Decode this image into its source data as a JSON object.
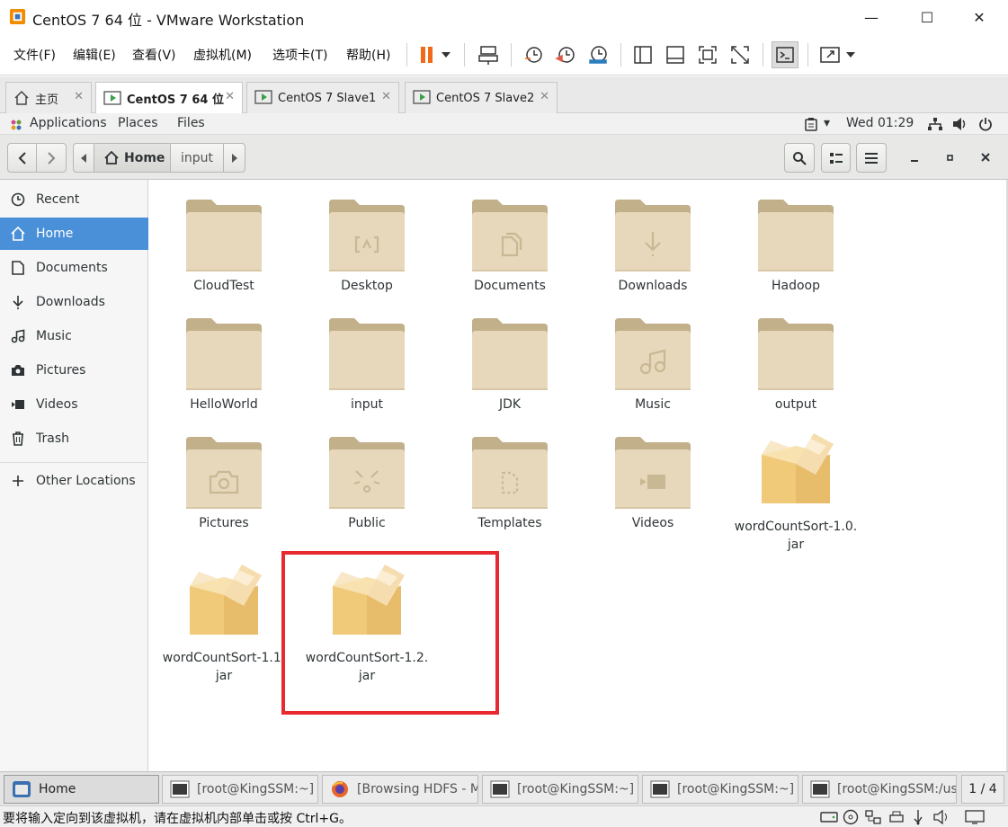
{
  "window": {
    "title": "CentOS 7 64 位 - VMware Workstation",
    "minimize": "—",
    "maximize": "☐",
    "close": "✕"
  },
  "menu": {
    "items": [
      "文件(F)",
      "编辑(E)",
      "查看(V)",
      "虚拟机(M)",
      "选项卡(T)",
      "帮助(H)"
    ]
  },
  "vm_tabs": [
    {
      "label": "主页",
      "icon": "home-icon"
    },
    {
      "label": "CentOS 7 64 位",
      "icon": "vm-play-icon",
      "active": true
    },
    {
      "label": "CentOS 7 Slave1",
      "icon": "vm-play-icon"
    },
    {
      "label": "CentOS 7 Slave2",
      "icon": "vm-play-icon"
    }
  ],
  "gnome_bar": {
    "applications": "Applications",
    "places": "Places",
    "files": "Files",
    "clock": "Wed 01:29"
  },
  "nautilus": {
    "path": [
      "Home",
      "input"
    ]
  },
  "sidebar": {
    "items": [
      {
        "label": "Recent",
        "icon": "clock-icon"
      },
      {
        "label": "Home",
        "icon": "home-icon",
        "active": true
      },
      {
        "label": "Documents",
        "icon": "document-icon"
      },
      {
        "label": "Downloads",
        "icon": "download-icon"
      },
      {
        "label": "Music",
        "icon": "music-icon"
      },
      {
        "label": "Pictures",
        "icon": "camera-icon"
      },
      {
        "label": "Videos",
        "icon": "video-icon"
      },
      {
        "label": "Trash",
        "icon": "trash-icon"
      }
    ],
    "other": {
      "label": "Other Locations",
      "icon": "plus-icon"
    }
  },
  "files": [
    {
      "name": "CloudTest",
      "type": "folder",
      "emblem": ""
    },
    {
      "name": "Desktop",
      "type": "folder",
      "emblem": "desktop"
    },
    {
      "name": "Documents",
      "type": "folder",
      "emblem": "documents"
    },
    {
      "name": "Downloads",
      "type": "folder",
      "emblem": "downloads"
    },
    {
      "name": "Hadoop",
      "type": "folder",
      "emblem": ""
    },
    {
      "name": "HelloWorld",
      "type": "folder",
      "emblem": ""
    },
    {
      "name": "input",
      "type": "folder",
      "emblem": ""
    },
    {
      "name": "JDK",
      "type": "folder",
      "emblem": ""
    },
    {
      "name": "Music",
      "type": "folder",
      "emblem": "music"
    },
    {
      "name": "output",
      "type": "folder",
      "emblem": ""
    },
    {
      "name": "Pictures",
      "type": "folder",
      "emblem": "pictures"
    },
    {
      "name": "Public",
      "type": "folder",
      "emblem": "public"
    },
    {
      "name": "Templates",
      "type": "folder",
      "emblem": "templates"
    },
    {
      "name": "Videos",
      "type": "folder",
      "emblem": "videos"
    },
    {
      "name": "wordCountSort-1.0.\njar",
      "type": "package",
      "emblem": ""
    },
    {
      "name": "wordCountSort-1.1.\njar",
      "type": "package",
      "emblem": ""
    },
    {
      "name": "wordCountSort-1.2.\njar",
      "type": "package",
      "emblem": ""
    }
  ],
  "taskbar": {
    "tasks": [
      {
        "label": "Home",
        "icon": "files-icon",
        "active": true
      },
      {
        "label": "[root@KingSSM:~]",
        "icon": "terminal-icon"
      },
      {
        "label": "[Browsing HDFS - M...",
        "icon": "firefox-icon"
      },
      {
        "label": "[root@KingSSM:~]",
        "icon": "terminal-icon"
      },
      {
        "label": "[root@KingSSM:~]",
        "icon": "terminal-icon"
      },
      {
        "label": "[root@KingSSM:/usr...",
        "icon": "terminal-icon"
      }
    ],
    "workspace": "1 / 4"
  },
  "status": {
    "text": "要将输入定向到该虚拟机，请在虚拟机内部单击或按 Ctrl+G。"
  },
  "colors": {
    "accent": "#4a90d9",
    "highlight_box": "#e8292f",
    "folder": "#e8d8bb"
  }
}
